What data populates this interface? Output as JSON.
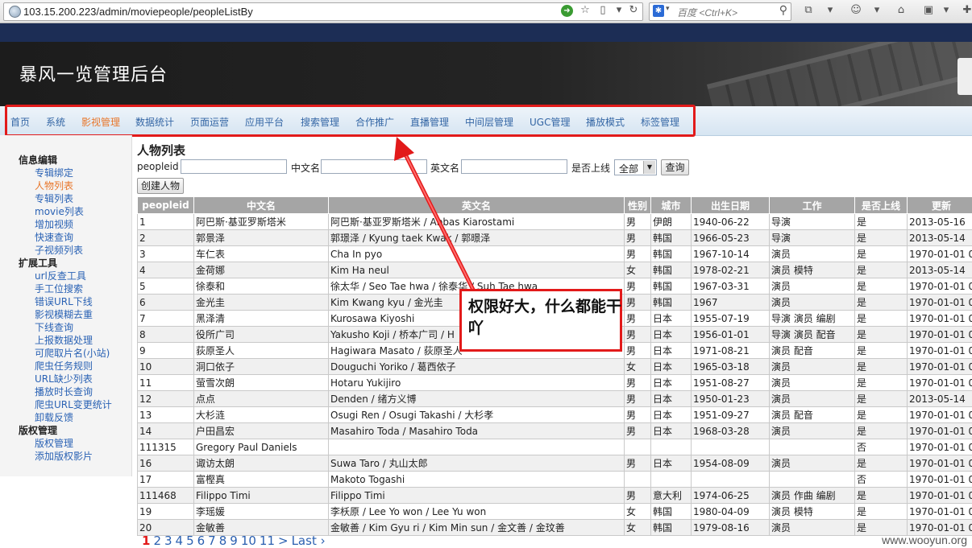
{
  "browser": {
    "url": "103.15.200.223/admin/moviepeople/peopleListBy",
    "search_placeholder": "百度 <Ctrl+K>"
  },
  "header": {
    "title": "暴风一览管理后台"
  },
  "nav": {
    "items": [
      "首页",
      "系统",
      "影视管理",
      "数据统计",
      "页面运营",
      "应用平台",
      "搜索管理",
      "合作推广",
      "直播管理",
      "中间层管理",
      "UGC管理",
      "播放模式",
      "标签管理"
    ],
    "active_index": 2
  },
  "sidebar": {
    "sections": [
      {
        "title": "信息编辑",
        "items": [
          "专辑绑定",
          "人物列表",
          "专辑列表",
          "movie列表",
          "增加视频",
          "快速查询",
          "子视频列表"
        ]
      },
      {
        "title": "扩展工具",
        "items": [
          "url反查工具",
          "手工位搜索",
          "错误URL下线",
          "影视模糊去重",
          "下线查询",
          "上报数据处理",
          "可爬取片名(小站)",
          "爬虫任务规则",
          "URL缺少列表",
          "播放时长查询",
          "爬虫URL变更统计",
          "卸载反馈"
        ]
      },
      {
        "title": "版权管理",
        "items": [
          "版权管理",
          "添加版权影片"
        ]
      }
    ],
    "active_item": "人物列表"
  },
  "main": {
    "title": "人物列表",
    "filters": {
      "peopleid_label": "peopleid",
      "cn_label": "中文名",
      "en_label": "英文名",
      "online_label": "是否上线",
      "online_value": "全部",
      "query_button": "查询"
    },
    "create_button": "创建人物",
    "table": {
      "headers": [
        "peopleid",
        "中文名",
        "英文名",
        "性别",
        "城市",
        "出生日期",
        "工作",
        "是否上线",
        "更新"
      ],
      "rows": [
        [
          "1",
          "阿巴斯·基亚罗斯塔米",
          "阿巴斯·基亚罗斯塔米 / Abbas Kiarostami",
          "男",
          "伊朗",
          "1940-06-22",
          "导演",
          "是",
          "2013-05-16"
        ],
        [
          "2",
          "郭景泽",
          "郭璟泽 / Kyung taek Kwak / 郭暻泽",
          "男",
          "韩国",
          "1966-05-23",
          "导演",
          "是",
          "2013-05-14"
        ],
        [
          "3",
          "车仁表",
          "Cha In pyo",
          "男",
          "韩国",
          "1967-10-14",
          "演员",
          "是",
          "1970-01-01 0"
        ],
        [
          "4",
          "金荷娜",
          "Kim Ha neul",
          "女",
          "韩国",
          "1978-02-21",
          "演员 模特",
          "是",
          "2013-05-14"
        ],
        [
          "5",
          "徐泰和",
          "徐太华 / Seo Tae hwa / 徐泰华 / Suh Tae hwa",
          "男",
          "韩国",
          "1967-03-31",
          "演员",
          "是",
          "1970-01-01 0"
        ],
        [
          "6",
          "金光圭",
          "Kim Kwang kyu / 金光圭",
          "男",
          "韩国",
          "1967",
          "演员",
          "是",
          "1970-01-01 0"
        ],
        [
          "7",
          "黑泽清",
          "Kurosawa Kiyoshi",
          "男",
          "日本",
          "1955-07-19",
          "导演 演员 编剧",
          "是",
          "1970-01-01 0"
        ],
        [
          "8",
          "役所广司",
          "Yakusho Koji / 桥本广司 / H",
          "男",
          "日本",
          "1956-01-01",
          "导演 演员 配音",
          "是",
          "1970-01-01 0"
        ],
        [
          "9",
          "荻原圣人",
          "Hagiwara Masato / 荻原圣人",
          "男",
          "日本",
          "1971-08-21",
          "演员 配音",
          "是",
          "1970-01-01 0"
        ],
        [
          "10",
          "洞口依子",
          "Douguchi Yoriko / 葛西依子",
          "女",
          "日本",
          "1965-03-18",
          "演员",
          "是",
          "1970-01-01 0"
        ],
        [
          "11",
          "萤雪次朗",
          "Hotaru Yukijiro",
          "男",
          "日本",
          "1951-08-27",
          "演员",
          "是",
          "1970-01-01 0"
        ],
        [
          "12",
          "点点",
          "Denden / 绪方义博",
          "男",
          "日本",
          "1950-01-23",
          "演员",
          "是",
          "2013-05-14"
        ],
        [
          "13",
          "大杉涟",
          "Osugi Ren / Osugi Takashi / 大杉孝",
          "男",
          "日本",
          "1951-09-27",
          "演员 配音",
          "是",
          "1970-01-01 0"
        ],
        [
          "14",
          "户田昌宏",
          "Masahiro Toda / Masahiro Toda",
          "男",
          "日本",
          "1968-03-28",
          "演员",
          "是",
          "1970-01-01 0"
        ],
        [
          "111315",
          "Gregory Paul Daniels",
          "",
          "",
          "",
          "",
          "",
          "否",
          "1970-01-01 0"
        ],
        [
          "16",
          "诹访太朗",
          "Suwa Taro / 丸山太郎",
          "男",
          "日本",
          "1954-08-09",
          "演员",
          "是",
          "1970-01-01 0"
        ],
        [
          "17",
          "富樫真",
          "Makoto Togashi",
          "",
          "",
          "",
          "",
          "否",
          "1970-01-01 0"
        ],
        [
          "111468",
          "Filippo Timi",
          "Filippo Timi",
          "男",
          "意大利",
          "1974-06-25",
          "演员 作曲 编剧",
          "是",
          "1970-01-01 0"
        ],
        [
          "19",
          "李瑶媛",
          "李枖原 / Lee Yo won / Lee Yu won",
          "女",
          "韩国",
          "1980-04-09",
          "演员 模特",
          "是",
          "1970-01-01 0"
        ],
        [
          "20",
          "金敏善",
          "金敏善 / Kim Gyu ri / Kim Min sun / 金文善 / 金玟善",
          "女",
          "韩国",
          "1979-08-16",
          "演员",
          "是",
          "1970-01-01 0"
        ]
      ]
    },
    "pager": {
      "current": "1",
      "pages": [
        "2",
        "3",
        "4",
        "5",
        "6",
        "7",
        "8",
        "9",
        "10",
        "11"
      ],
      "next": ">",
      "last": "Last ›"
    }
  },
  "annotation": {
    "text": "权限好大，什么都能干吖",
    "color": "#e21a1a"
  },
  "watermark": "www.wooyun.org"
}
